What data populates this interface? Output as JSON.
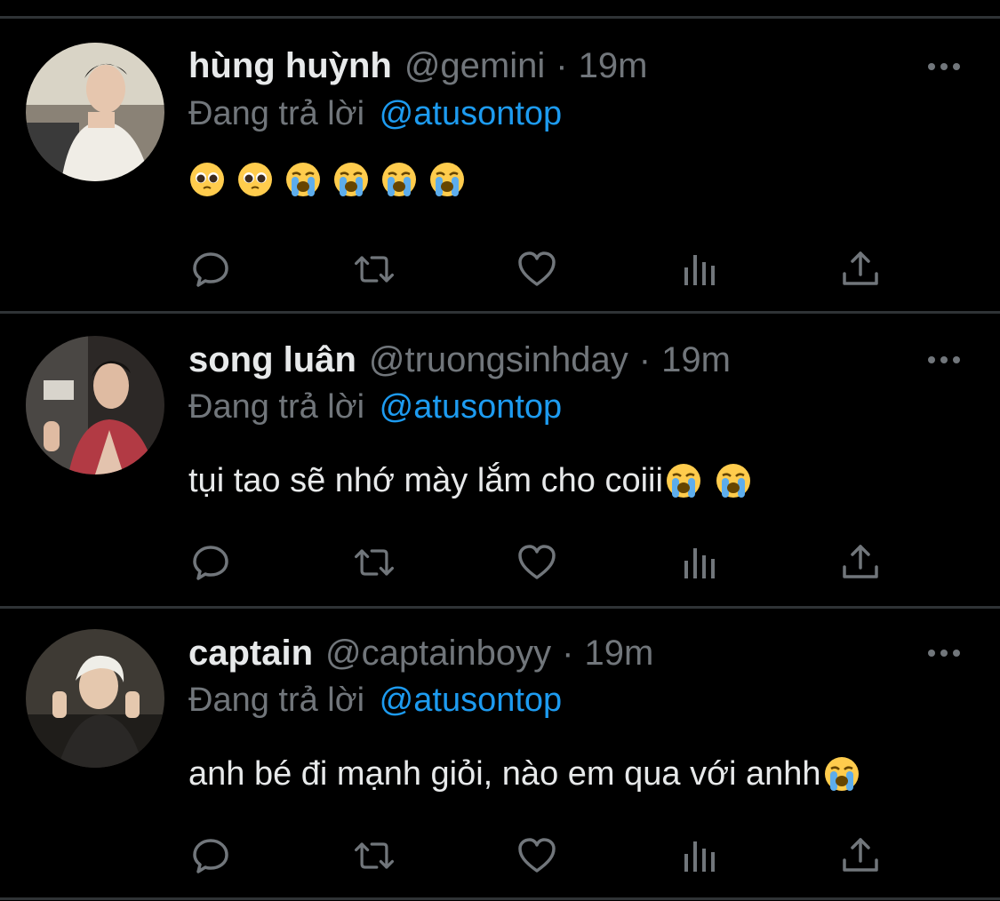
{
  "colors": {
    "background": "#000000",
    "text_primary": "#e7e9ea",
    "text_secondary": "#71767b",
    "mention": "#1d9bf0",
    "divider": "#2f3336"
  },
  "tweets": [
    {
      "name": "hùng huỳnh",
      "handle": "@gemini",
      "separator": "·",
      "time": "19m",
      "replying_prefix": "Đang trả lời",
      "replying_to": "@atusontop",
      "text": "",
      "emojis": [
        "pleading-face",
        "pleading-face",
        "loudly-crying-face",
        "loudly-crying-face",
        "loudly-crying-face",
        "loudly-crying-face"
      ],
      "avatar": "avatar-hung-huynh"
    },
    {
      "name": "song luân",
      "handle": "@truongsinhday",
      "separator": "·",
      "time": "19m",
      "replying_prefix": "Đang trả lời",
      "replying_to": "@atusontop",
      "text": "tụi tao sẽ nhớ mày lắm cho coiii",
      "emojis": [
        "loudly-crying-face",
        "loudly-crying-face"
      ],
      "avatar": "avatar-song-luan"
    },
    {
      "name": "captain",
      "handle": "@captainboyy",
      "separator": "·",
      "time": "19m",
      "replying_prefix": "Đang trả lời",
      "replying_to": "@atusontop",
      "text": "anh bé đi mạnh giỏi, nào em qua với anhh",
      "emojis": [
        "loudly-crying-face"
      ],
      "avatar": "avatar-captain"
    }
  ],
  "action_icons": [
    "reply-icon",
    "retweet-icon",
    "like-icon",
    "analytics-icon",
    "share-icon"
  ],
  "more_icon": "more-options-icon"
}
